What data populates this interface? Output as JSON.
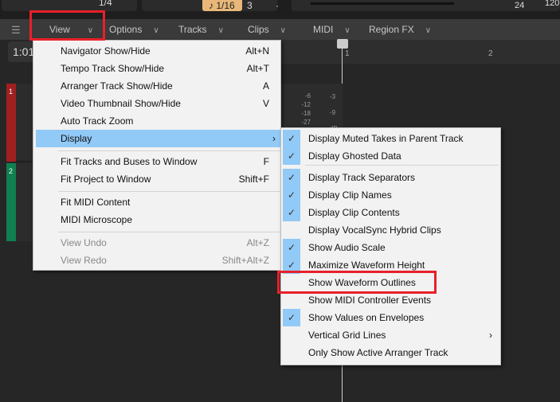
{
  "toolbar": {
    "snap": "1/4",
    "grid": "1/16",
    "count": "3",
    "dot": "·",
    "tempo_num": "24",
    "tempo": "120."
  },
  "timecode": "1:01",
  "ruler": [
    "1",
    "2"
  ],
  "menubar": [
    {
      "label": "View"
    },
    {
      "label": "Options"
    },
    {
      "label": "Tracks"
    },
    {
      "label": "Clips"
    },
    {
      "label": "MIDI"
    },
    {
      "label": "Region FX"
    }
  ],
  "tracks": [
    {
      "number": "1",
      "color": "#a02020"
    },
    {
      "number": "2",
      "color": "#108050"
    }
  ],
  "meter_labels": [
    "-6",
    "-12",
    "-18",
    "-27",
    "-3",
    "-9",
    "dB"
  ],
  "view_menu": [
    {
      "label": "Navigator Show/Hide",
      "shortcut": "Alt+N"
    },
    {
      "label": "Tempo Track Show/Hide",
      "shortcut": "Alt+T"
    },
    {
      "label": "Arranger Track Show/Hide",
      "shortcut": "A"
    },
    {
      "label": "Video Thumbnail Show/Hide",
      "shortcut": "V"
    },
    {
      "label": "Auto Track Zoom",
      "shortcut": ""
    },
    {
      "label": "Display",
      "shortcut": "›",
      "highlighted": true
    },
    {
      "label": "Fit Tracks and Buses to Window",
      "shortcut": "F"
    },
    {
      "label": "Fit Project to Window",
      "shortcut": "Shift+F"
    },
    {
      "label": "Fit MIDI Content",
      "shortcut": ""
    },
    {
      "label": "MIDI Microscope",
      "shortcut": ""
    },
    {
      "label": "View Undo",
      "shortcut": "Alt+Z",
      "disabled": true
    },
    {
      "label": "View Redo",
      "shortcut": "Shift+Alt+Z",
      "disabled": true
    }
  ],
  "display_submenu": [
    {
      "label": "Display Muted Takes in Parent Track",
      "checked": true
    },
    {
      "label": "Display Ghosted Data",
      "checked": true
    },
    {
      "label": "Display Track Separators",
      "checked": true
    },
    {
      "label": "Display Clip Names",
      "checked": true
    },
    {
      "label": "Display Clip Contents",
      "checked": true
    },
    {
      "label": "Display VocalSync Hybrid Clips",
      "checked": false
    },
    {
      "label": "Show Audio Scale",
      "checked": true
    },
    {
      "label": "Maximize Waveform Height",
      "checked": true
    },
    {
      "label": "Show Waveform Outlines",
      "checked": false
    },
    {
      "label": "Show MIDI Controller Events",
      "checked": false
    },
    {
      "label": "Show Values on Envelopes",
      "checked": true
    },
    {
      "label": "Vertical Grid Lines",
      "checked": false,
      "submenu": "›"
    },
    {
      "label": "Only Show Active Arranger Track",
      "checked": false
    }
  ],
  "check_glyph": "✓",
  "colors": {
    "highlight": "#91c9f7",
    "annotation": "#e8202a",
    "grid_button": "#e8b878"
  }
}
